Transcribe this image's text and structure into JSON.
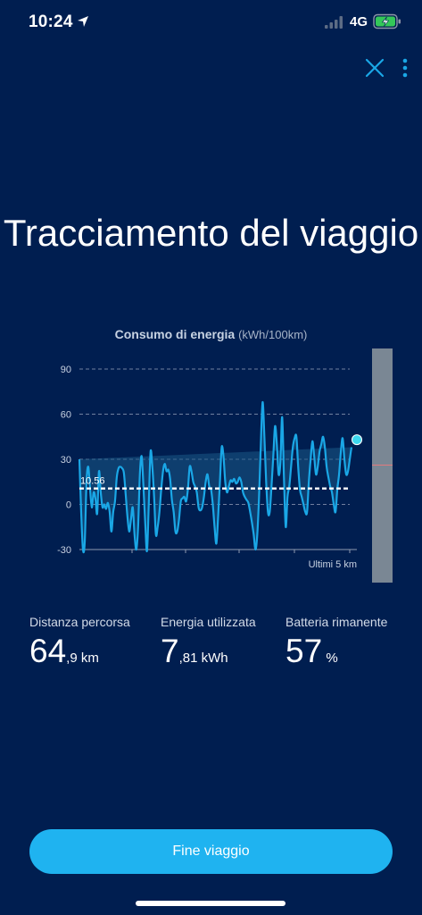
{
  "status_bar": {
    "time": "10:24",
    "network": "4G",
    "icons": [
      "location-arrow-icon",
      "cellular-signal-icon",
      "battery-charging-icon"
    ]
  },
  "top_actions": {
    "icons": [
      "close-icon",
      "more-vertical-icon"
    ]
  },
  "title": "Tracciamento del viaggio",
  "chart_title": {
    "label": "Consumo di energia",
    "unit": "(kWh/100km)"
  },
  "chart_data": {
    "type": "area",
    "title": "Consumo di energia",
    "ylabel": "(kWh/100km)",
    "xlabel": "Ultimi 5 km",
    "ylim": [
      -30,
      90
    ],
    "yticks": [
      90,
      60,
      30,
      0,
      -30
    ],
    "grid": true,
    "average": 10.56,
    "average_label": "10.56",
    "colors": {
      "line": "#1aa7e6",
      "fill": "#1a5a86",
      "average": "#ffffff",
      "grid": "#7080a0"
    },
    "x": [
      0,
      1,
      2,
      3,
      4,
      5,
      6,
      7,
      8,
      9,
      10,
      11,
      12,
      13,
      14,
      15,
      16,
      17,
      18,
      19,
      20,
      21,
      22,
      23,
      24,
      25,
      26,
      27,
      28,
      29,
      30,
      31,
      32,
      33,
      34,
      35,
      36,
      37,
      38,
      39,
      40,
      41,
      42,
      43,
      44,
      45,
      46,
      47,
      48,
      49,
      50,
      51,
      52,
      53,
      54,
      55,
      56,
      57,
      58,
      59,
      60,
      61,
      62,
      63,
      64,
      65,
      66,
      67,
      68,
      69,
      70,
      71,
      72,
      73,
      74,
      75,
      76,
      77,
      78,
      79,
      80,
      81,
      82,
      83,
      84,
      85,
      86,
      87,
      88,
      89,
      90,
      91,
      92,
      93,
      94,
      95,
      96,
      97,
      98,
      99,
      100,
      101,
      102,
      103,
      104,
      105,
      106,
      107,
      108,
      109,
      110,
      111,
      112,
      113,
      114,
      115,
      116,
      117,
      118,
      119,
      120,
      121,
      122,
      123,
      124,
      125,
      126,
      127,
      128,
      129,
      130,
      131,
      132,
      133,
      134,
      135,
      136,
      137,
      138,
      139,
      140,
      141,
      142,
      143,
      144,
      145,
      146,
      147,
      148,
      149,
      150,
      151,
      152,
      153,
      154,
      155,
      156
    ],
    "values": [
      30,
      -5,
      -30,
      -25,
      15,
      25,
      10,
      -2,
      8,
      4,
      -6,
      22,
      8,
      -2,
      0,
      -3,
      1,
      -5,
      -18,
      -5,
      2,
      18,
      24,
      25,
      24,
      21,
      7,
      -8,
      -18,
      -10,
      -2,
      -20,
      -30,
      -15,
      20,
      32,
      12,
      -12,
      -31,
      0,
      35,
      25,
      5,
      -20,
      -15,
      -5,
      10,
      22,
      27,
      22,
      23,
      17,
      3,
      -5,
      -18,
      -18,
      -10,
      2,
      4,
      5,
      2,
      10,
      25,
      22,
      15,
      12,
      8,
      -2,
      -4,
      -2,
      5,
      15,
      20,
      12,
      10,
      0,
      -15,
      -26,
      -8,
      15,
      38,
      32,
      15,
      8,
      12,
      16,
      15,
      17,
      14,
      15,
      18,
      15,
      8,
      5,
      3,
      1,
      -5,
      -12,
      -20,
      -30,
      -20,
      5,
      40,
      68,
      45,
      15,
      -5,
      -5,
      12,
      32,
      52,
      40,
      20,
      28,
      58,
      18,
      -15,
      5,
      12,
      25,
      38,
      44,
      45,
      25,
      10,
      5,
      0,
      -5,
      -5,
      15,
      30,
      42,
      32,
      20,
      25,
      35,
      40,
      45,
      38,
      25,
      18,
      12,
      8,
      0,
      -5,
      10,
      20,
      35,
      44,
      30,
      20,
      22,
      30,
      38,
      42
    ],
    "current_value": 43
  },
  "stats": [
    {
      "label": "Distanza percorsa",
      "main": "64",
      "sub": ",9 km"
    },
    {
      "label": "Energia utilizzata",
      "main": "7",
      "sub": ",81 kWh"
    },
    {
      "label": "Batteria rimanente",
      "main": "57",
      "sub": " %"
    }
  ],
  "end_button": {
    "label": "Fine viaggio"
  }
}
